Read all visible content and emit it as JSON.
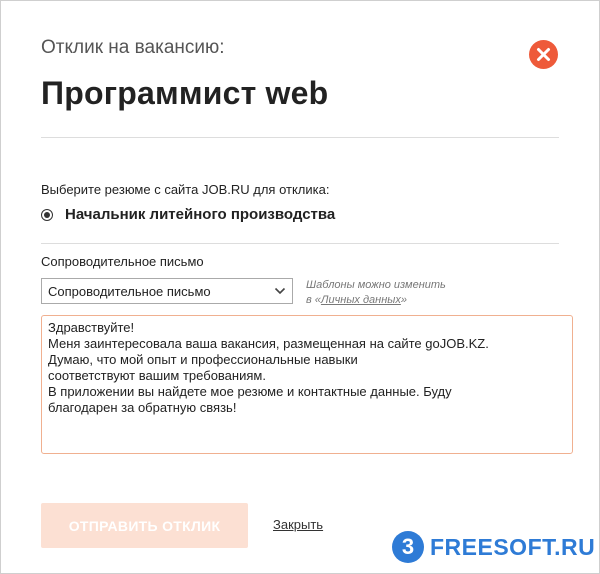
{
  "modal": {
    "subtitle": "Отклик на вакансию:",
    "title": "Программист web",
    "close_icon": "close-icon",
    "close_color": "#ee5a3a"
  },
  "resume": {
    "label": "Выберите резюме с сайта JOB.RU для отклика:",
    "selected": "Начальник литейного производства"
  },
  "cover_letter": {
    "label": "Сопроводительное письмо",
    "template_selected": "Сопроводительное письмо",
    "hint_prefix": "Шаблоны можно изменить",
    "hint_in": "в «",
    "hint_link": "Личных данных",
    "hint_suffix": "»",
    "text": "Здравствуйте!\nМеня заинтересовала ваша вакансия, размещенная на сайте goJOB.KZ.\nДумаю, что мой опыт и профессиональные навыки\nсоответствуют вашим требованиям.\nВ приложении вы найдете мое резюме и контактные данные. Буду\nблагодарен за обратную связь!"
  },
  "actions": {
    "submit_label": "ОТПРАВИТЬ ОТКЛИК",
    "close_label": "Закрыть"
  },
  "watermark": {
    "badge": "3",
    "text": "FREESOFT.RU"
  },
  "colors": {
    "accent": "#ee5a3a",
    "submit_bg": "#fce0d3",
    "watermark": "#2e7bd6"
  }
}
